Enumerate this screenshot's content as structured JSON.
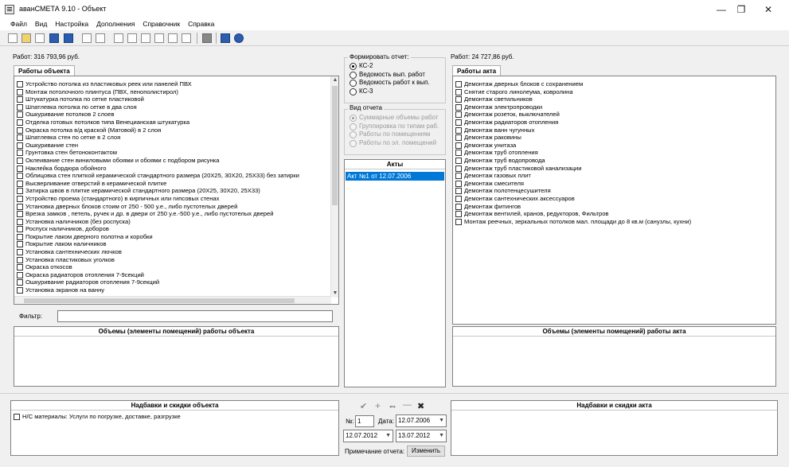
{
  "window": {
    "title": "аванСМЕТА 9.10 - Объект",
    "minimize": "—",
    "restore": "❐",
    "close": "✕"
  },
  "menu": [
    "Файл",
    "Вид",
    "Настройка",
    "Дополнения",
    "Справочник",
    "Справка"
  ],
  "left": {
    "total": "Работ: 316 793,96 руб.",
    "tab": "Работы объекта",
    "works": [
      "Устройство потолка из пластиковых реек или панелей ПВХ",
      "Монтаж потолочного плинтуса (ПВХ, пенополистирол)",
      "Штукатурка потолка по сетке пластиковой",
      "Шпатлевка потолка по сетке в два слоя",
      "Ошкуривание потолков 2 слоев",
      "Отделка готовых потолков типа Венецианская штукатурка",
      "Окраска потолка в/д краской (Матовой) в 2 слоя",
      "Шпатлевка стен по сетке в 2 слоя",
      "Ошкуривание стен",
      "Грунтовка стен бетоноконтактом",
      "Оклеивание стен виниловыми обоями и обоями с подбором рисунка",
      "Наклейка бордюра обойного",
      "Облицовка стен плиткой керамической стандартного размера (20Х25, 30Х20, 25Х33) без затирки",
      "Высверливание отверстий в керамической плитке",
      "Затирка швов в плитке керамической стандартного размера (20Х25, 30Х20, 25Х33)",
      "Устройство проема (стандартного) в  кирпичных или гипсовых стенах",
      "Установка дверных блоков стоим от 250 - 500 у.е., либо пустотелых дверей",
      "Врезка замков , петель, ручек и др. в двери от 250 у.е.-500 у.е., либо пустотелых дверей",
      "Установка наличников (без роспуска)",
      "Роспуск наличников, доборов",
      "Покрытие лаком дверного полотна и коробки",
      "Покрытие лаком наличников",
      "Установка сантехнических лючков",
      "Установка пластиковых уголков",
      "Окраска откосов",
      "Окраска радиаторов отопления 7-9секций",
      "Ошкуривание радиаторов отопления 7-9секций",
      "Установка экранов на ванну"
    ],
    "filter_label": "Фильтр:",
    "volumes_header": "Объемы (элементы помещений) работы объекта",
    "surcharges_header": "Надбавки и скидки объекта",
    "surcharges": [
      "Н/С материалы: Услуги по погрузке, доставке, разгрузке"
    ]
  },
  "middle": {
    "report_title": "Формировать отчет:",
    "reports": [
      {
        "label": "КС-2",
        "selected": true
      },
      {
        "label": "Ведомость вып. работ",
        "selected": false
      },
      {
        "label": "Ведомость работ к вып.",
        "selected": false
      },
      {
        "label": "КС-3",
        "selected": false
      }
    ],
    "view_title": "Вид отчета",
    "views": [
      {
        "label": "Суммарные объемы работ",
        "selected": true
      },
      {
        "label": "Группировка по типам раб.",
        "selected": false
      },
      {
        "label": "Работы по помещениям",
        "selected": false
      },
      {
        "label": "Работы по эл. помещений",
        "selected": false
      }
    ],
    "acts_header": "Акты",
    "acts": [
      "Акт №1 от 12.07.2006"
    ],
    "act_tools": {
      "check": "✔",
      "add": "+",
      "swap": "⇔",
      "minus": "—",
      "delete": "✖"
    },
    "number_label": "№:",
    "number_value": "1",
    "date_label": "Дата:",
    "date_value": "12.07.2006",
    "date_from": "12.07.2012",
    "date_to": "13.07.2012",
    "note_label": "Примечание отчета:",
    "change_button": "Изменить"
  },
  "right": {
    "total": "Работ: 24 727,86 руб.",
    "tab": "Работы акта",
    "works": [
      "Демонтаж дверных блоков с сохранением",
      "Снятие старого линолеума, ковролина",
      "Демонтаж светильников",
      "Демонтаж электропроводки",
      "Демонтаж розеток, выключателей",
      "Демонтаж радиаторов отопления",
      "Демонтаж ванн чугунных",
      "Демонтаж раковины",
      "Демонтаж унитаза",
      "Демонтаж труб отопления",
      "Демонтаж труб водопровода",
      "Демонтаж труб пластиковой канализации",
      "Демонтаж газовых плит",
      "Демонтаж смесителя",
      "Демонтаж полотенцесушителя",
      "Демонтаж сантехнических аксессуаров",
      "Демонтаж фитингов",
      "Демонтаж вентилей, кранов, редукторов, Фильтров",
      "Монтаж реечных, зеркальных потолков мал. площади до 8 кв.м (санузлы, кухни)"
    ],
    "volumes_header": "Объемы (элементы помещений) работы акта",
    "surcharges_header": "Надбавки и скидки акта"
  },
  "colors": {
    "selection": "#0078d7",
    "icon_blue": "#2a5db0"
  }
}
